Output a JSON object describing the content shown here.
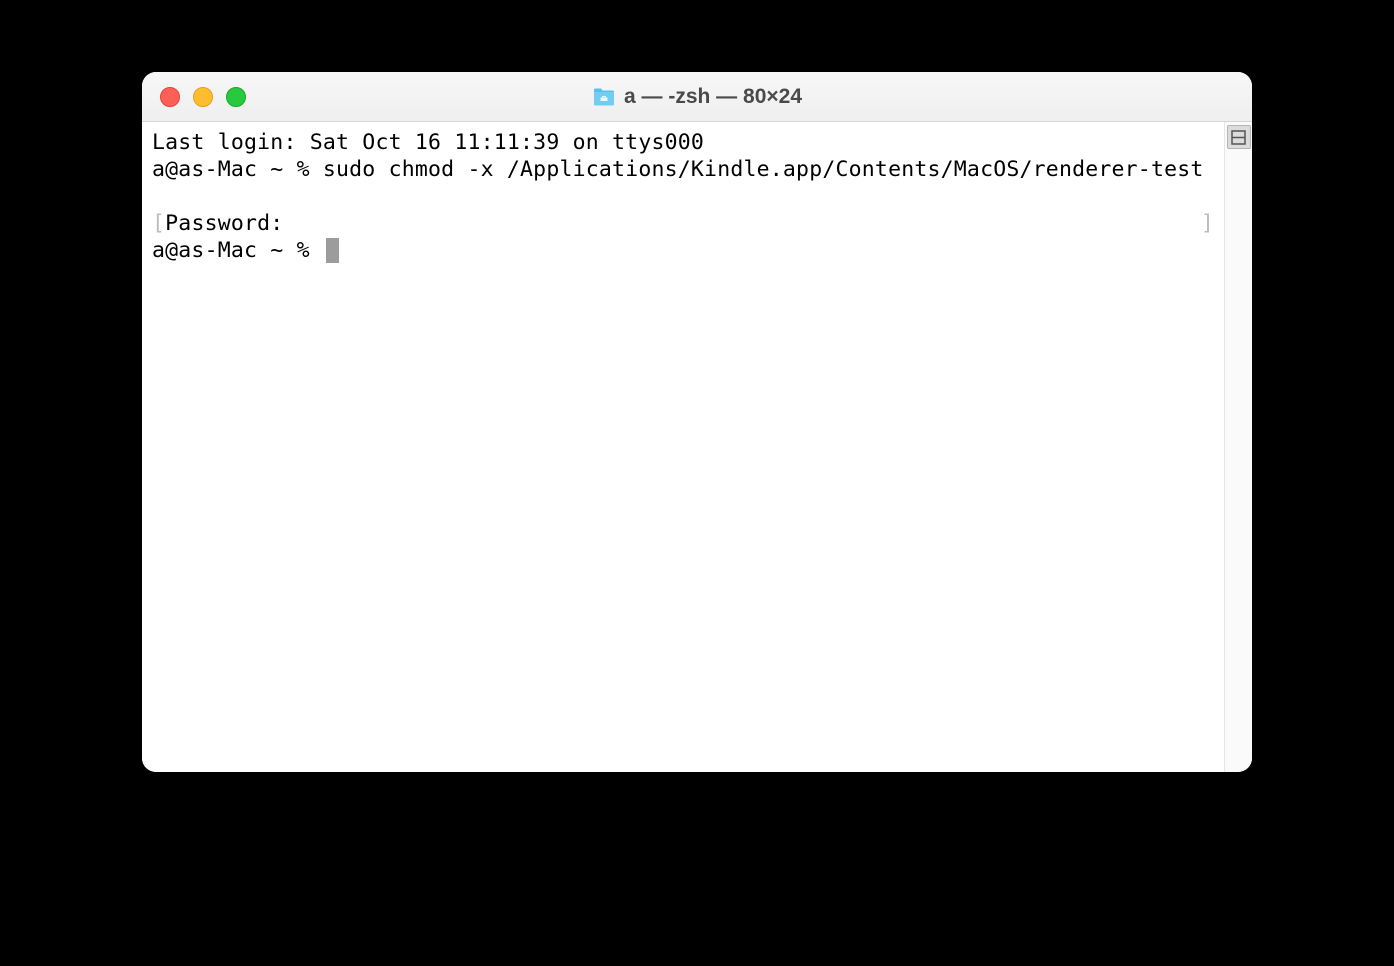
{
  "window": {
    "title": "a — -zsh — 80×24"
  },
  "terminal": {
    "line1": "Last login: Sat Oct 16 11:11:39 on ttys000",
    "line2_prompt": "a@as-Mac ~ % ",
    "line2_command": "sudo chmod -x /Applications/Kindle.app/Contents/MacOS/renderer-test",
    "line3_left_bracket": "[",
    "line3_text": "Password:",
    "line3_right_bracket": "]",
    "line4_prompt": "a@as-Mac ~ % "
  }
}
